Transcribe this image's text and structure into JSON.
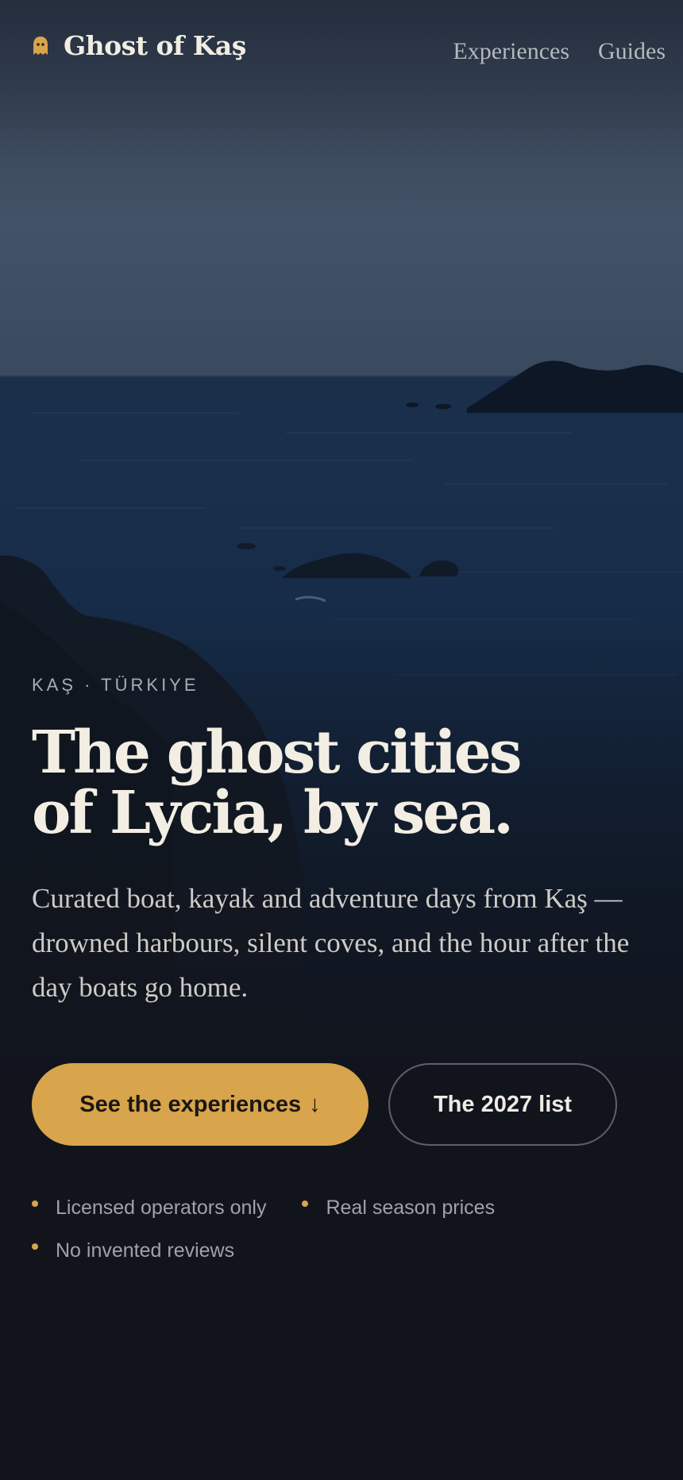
{
  "brand": {
    "name": "Ghost of Kaş",
    "icon": "ghost-icon",
    "accent_color": "#d8a44c"
  },
  "nav": {
    "links": [
      {
        "label": "Experiences"
      },
      {
        "label": "Guides"
      }
    ]
  },
  "hero": {
    "kicker": "KAŞ · TÜRKIYE",
    "headline_line1": "The ghost cities",
    "headline_line2": "of Lycia, by sea.",
    "lede": "Curated boat, kayak and adventure days from Kaş — drowned harbours, silent coves, and the hour after the day boats go home."
  },
  "ctas": {
    "primary_label": "See the experiences",
    "primary_icon": "arrow-down-icon",
    "primary_arrow": "↓",
    "secondary_label": "The 2027 list"
  },
  "trust": {
    "items": [
      "Licensed operators only",
      "Real season prices",
      "No invented reviews"
    ]
  }
}
